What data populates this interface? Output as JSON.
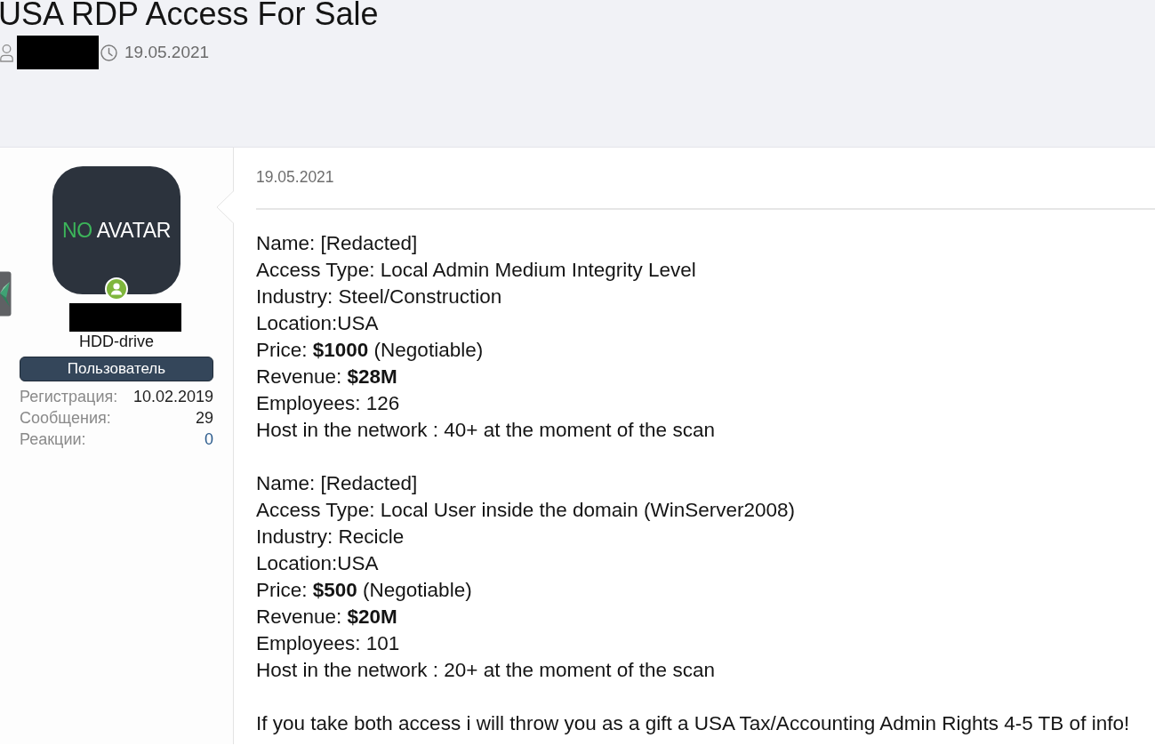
{
  "thread": {
    "title": "USA RDP Access For Sale",
    "author_redacted": true,
    "date": "19.05.2021"
  },
  "post": {
    "author": {
      "avatar": {
        "accent": "NO",
        "text": "AVATAR"
      },
      "online": true,
      "name_redacted": true,
      "user_title": "HDD-drive",
      "role": "Пользователь",
      "stats": [
        {
          "label": "Регистрация:",
          "value": "10.02.2019",
          "kind": "text"
        },
        {
          "label": "Сообщения:",
          "value": "29",
          "kind": "text"
        },
        {
          "label": "Реакции:",
          "value": "0",
          "kind": "link"
        }
      ]
    },
    "date": "19.05.2021",
    "blocks": [
      {
        "lines": [
          "Name: [Redacted]",
          "Access Type: Local Admin Medium Integrity Level",
          "Industry: Steel/Construction",
          "Location:USA",
          "Price: **$1000** (Negotiable)",
          "Revenue: **$28M**",
          "Employees: 126",
          "Host in the network : 40+ at the moment of the scan"
        ]
      },
      {
        "lines": [
          "Name: [Redacted]",
          "Access Type: Local User inside the domain (WinServer2008)",
          "Industry: Recicle",
          "Location:USA",
          "Price: **$500** (Negotiable)",
          "Revenue: **$20M**",
          "Employees: 101",
          "Host in the network : 20+ at the moment of the scan"
        ]
      },
      {
        "lines": [
          "If you take both access i will throw you as a gift a USA Tax/Accounting Admin Rights 4-5 TB of info!"
        ]
      }
    ]
  }
}
